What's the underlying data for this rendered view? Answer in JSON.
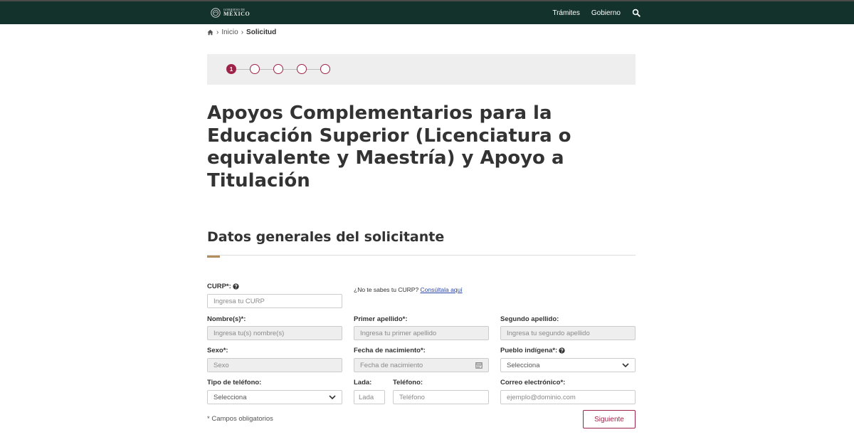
{
  "colors": {
    "navbar_bg": "#13322b",
    "accent": "#9d2449",
    "gold": "#b38e5d",
    "link": "#2b46a8",
    "panel_bg": "#eeeeee"
  },
  "header": {
    "logo_small": "GOBIERNO DE",
    "logo_big": "MÉXICO",
    "logo_icon": "national-seal-icon",
    "nav": [
      "Trámites",
      "Gobierno"
    ],
    "search_icon": "search-icon"
  },
  "breadcrumb": {
    "home_icon": "home-icon",
    "separator": "›",
    "items": [
      "Inicio",
      "Solicitud"
    ]
  },
  "stepper": {
    "total_steps": 5,
    "current_step": 1,
    "current_label": "1"
  },
  "page": {
    "title": "Apoyos Complementarios para la Educación Superior (Licenciatura o equivalente y Maestría) y Apoyo a Titulación"
  },
  "section": {
    "title": "Datos generales del solicitante"
  },
  "form": {
    "curp": {
      "label": "CURP*:",
      "placeholder": "Ingresa tu CURP",
      "help_icon": "question-circle-icon"
    },
    "curp_help": {
      "text": "¿No te sabes tu CURP? ",
      "link": "Consúltala aquí"
    },
    "nombre": {
      "label": "Nombre(s)*:",
      "placeholder": "Ingresa tu(s) nombre(s)"
    },
    "primer_apellido": {
      "label": "Primer apellido*:",
      "placeholder": "Ingresa tu primer apellido"
    },
    "segundo_apellido": {
      "label": "Segundo apellido:",
      "placeholder": "Ingresa tu segundo apellido"
    },
    "sexo": {
      "label": "Sexo*:",
      "placeholder": "Sexo"
    },
    "fecha_nacimiento": {
      "label": "Fecha de nacimiento*:",
      "placeholder": "Fecha de nacimiento",
      "icon": "calendar-icon"
    },
    "pueblo_indigena": {
      "label": "Pueblo indígena*:",
      "value": "Selecciona",
      "help_icon": "question-circle-icon"
    },
    "tipo_telefono": {
      "label": "Tipo de teléfono:",
      "value": "Selecciona"
    },
    "lada": {
      "label": "Lada:",
      "placeholder": "Lada"
    },
    "telefono": {
      "label": "Teléfono:",
      "placeholder": "Teléfono"
    },
    "correo": {
      "label": "Correo electrónico*:",
      "placeholder": "ejemplo@dominio.com"
    },
    "required_note": "* Campos obligatorios",
    "next_button": "Siguiente"
  }
}
